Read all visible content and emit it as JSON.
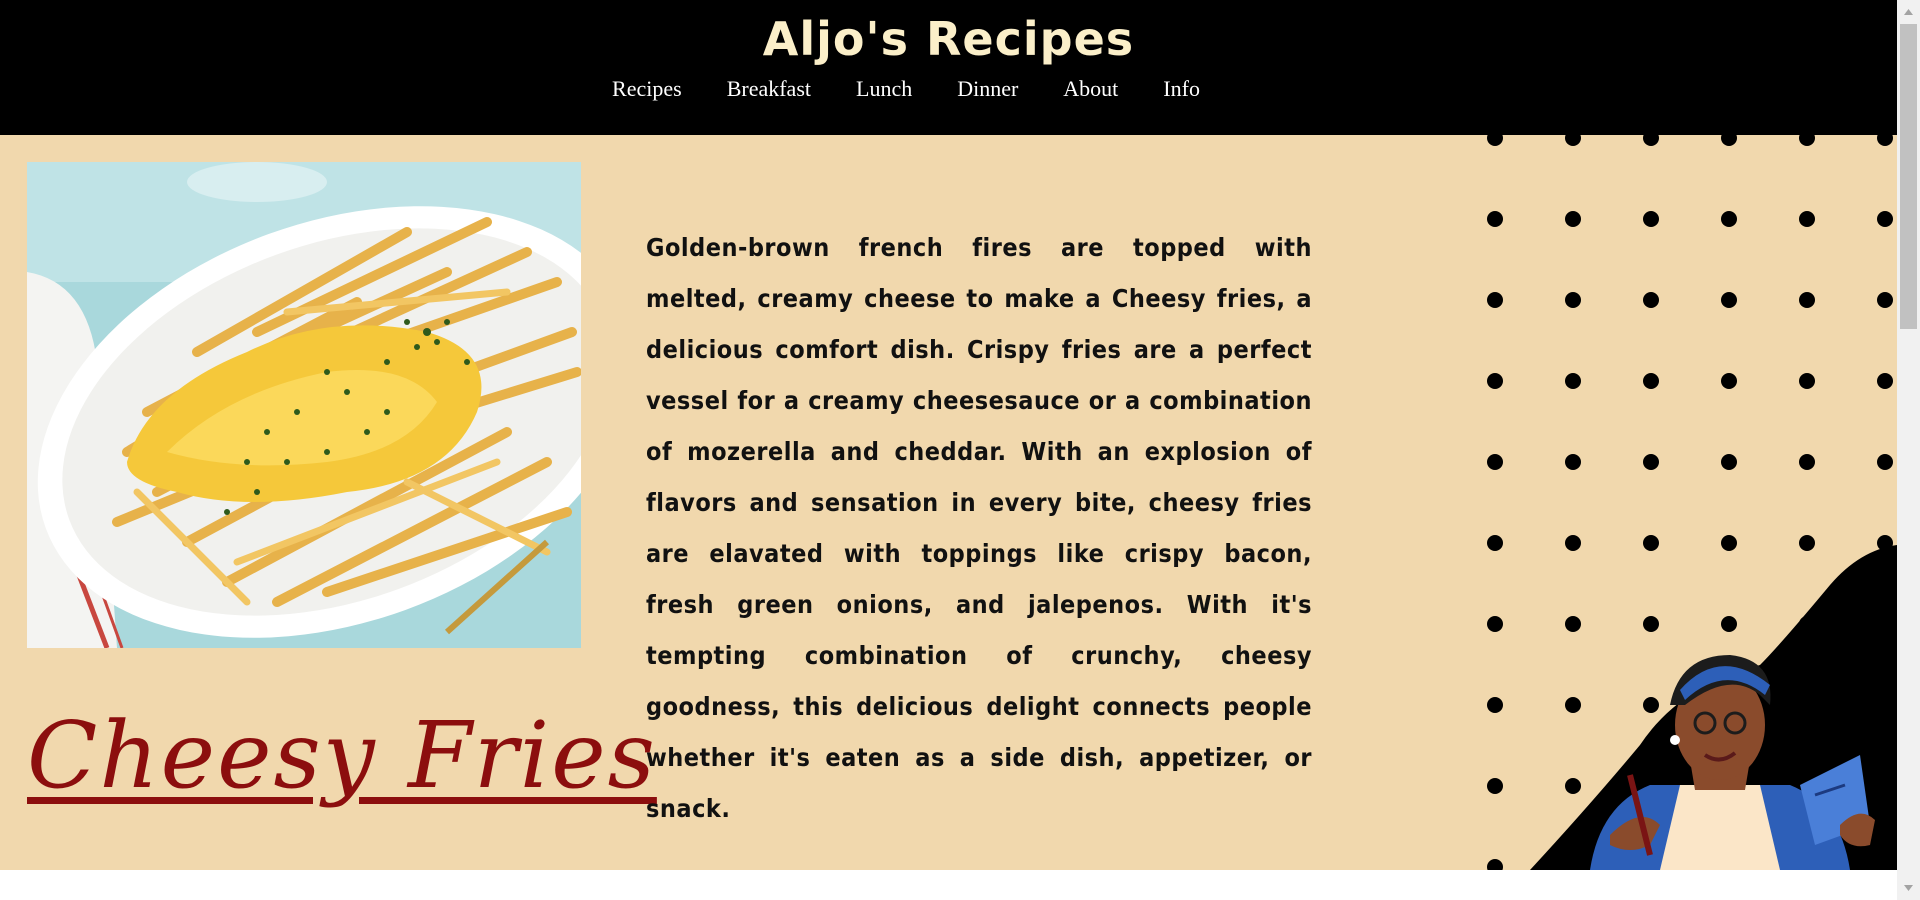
{
  "header": {
    "site_title": "Aljo's Recipes",
    "nav": [
      "Recipes",
      "Breakfast",
      "Lunch",
      "Dinner",
      "About",
      "Info"
    ]
  },
  "recipe": {
    "title": "Cheesy Fries",
    "description": "Golden-brown french fires are topped with melted, creamy cheese to make a Cheesy fries, a delicious comfort dish. Crispy fries are a perfect vessel for a creamy cheesesauce or a combination of mozerella and cheddar. With an explosion of flavors and sensation in every bite, cheesy fries are elavated with toppings like crispy bacon, fresh green onions, and jalepenos. With it's tempting combination of crunchy, cheesy goodness, this delicious delight connects people whether it's eaten as a side dish, appetizer, or snack.",
    "image_alt": "cheesy-fries-photo"
  },
  "colors": {
    "header_bg": "#000000",
    "title_color": "#fbefc9",
    "page_bg": "#f1d8ad",
    "accent_red": "#8c0e0e"
  }
}
